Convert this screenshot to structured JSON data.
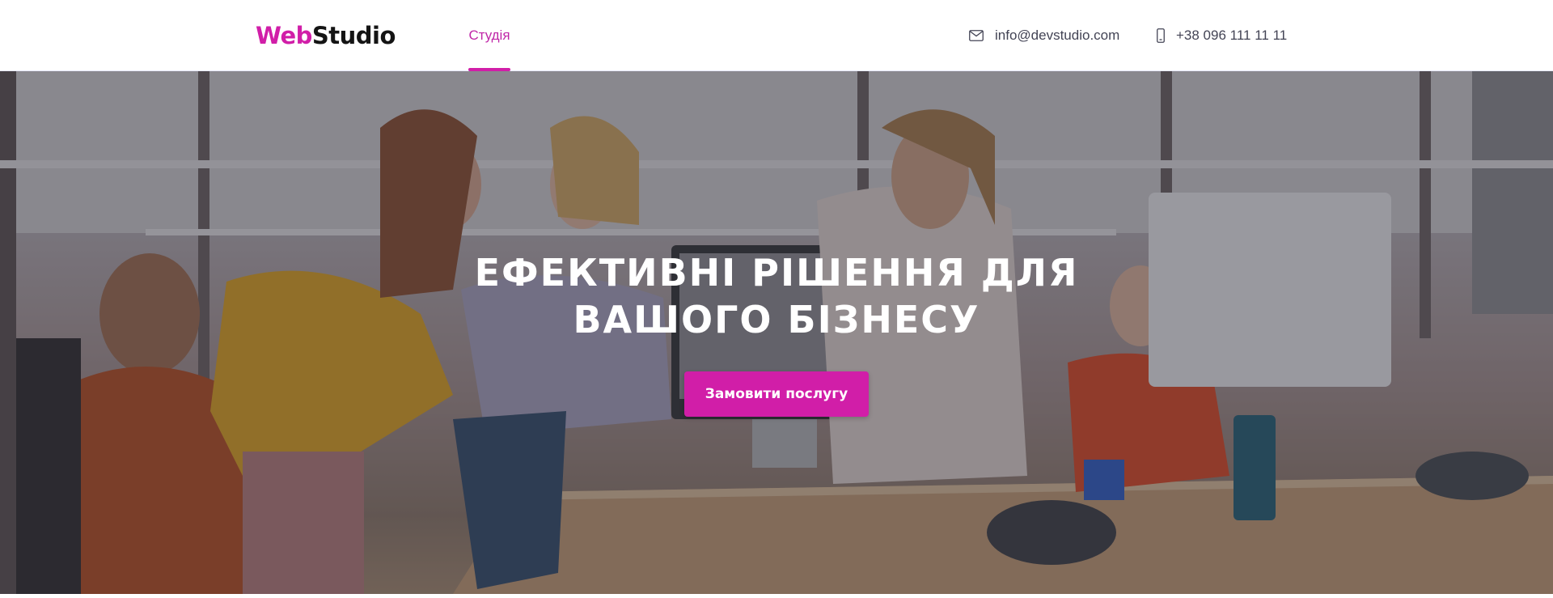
{
  "header": {
    "logo": {
      "accent": "Web",
      "rest": "Studio"
    },
    "nav": [
      {
        "label": "Студія",
        "active": true
      }
    ],
    "contacts": {
      "email": {
        "icon": "envelope-icon",
        "text": "info@devstudio.com"
      },
      "phone": {
        "icon": "smartphone-icon",
        "text": "+38 096 111 11 11"
      }
    }
  },
  "hero": {
    "title_line1": "ЕФЕКТИВНІ РІШЕННЯ ДЛЯ",
    "title_line2": "ВАШОГО БІЗНЕСУ",
    "button_label": "Замовити послугу"
  },
  "colors": {
    "accent": "#d11ea8",
    "text_dark": "#212121",
    "text_muted": "#434455",
    "overlay": "#2f303a"
  }
}
